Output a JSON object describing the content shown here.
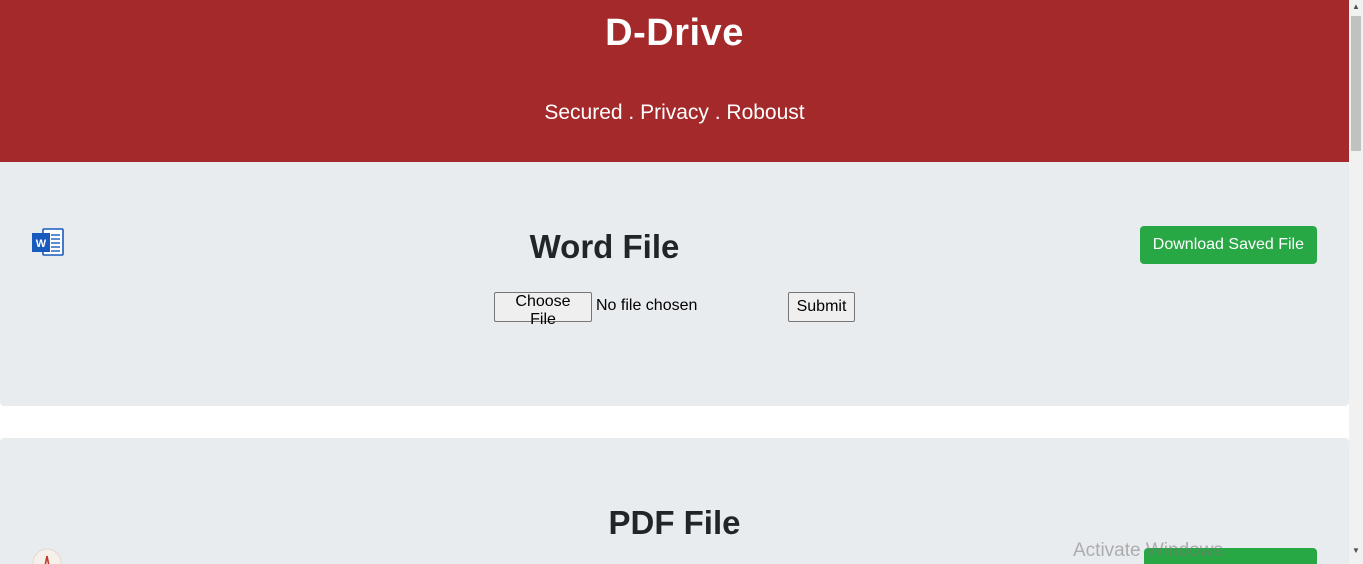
{
  "header": {
    "title": "D-Drive",
    "tagline": "Secured . Privacy . Roboust"
  },
  "word_card": {
    "heading": "Word File",
    "icon": "word-doc-icon",
    "download_label": "Download Saved File",
    "choose_file_label": "Choose File",
    "file_status": "No file chosen",
    "submit_label": "Submit"
  },
  "pdf_card": {
    "heading": "PDF File",
    "icon": "pdf-doc-icon"
  },
  "overlay": {
    "watermark": "Activate Windows"
  },
  "colors": {
    "header_bg": "#a4292a",
    "card_bg": "#e9ecef",
    "download_button": "#28a745",
    "word_icon": "#185abd"
  }
}
